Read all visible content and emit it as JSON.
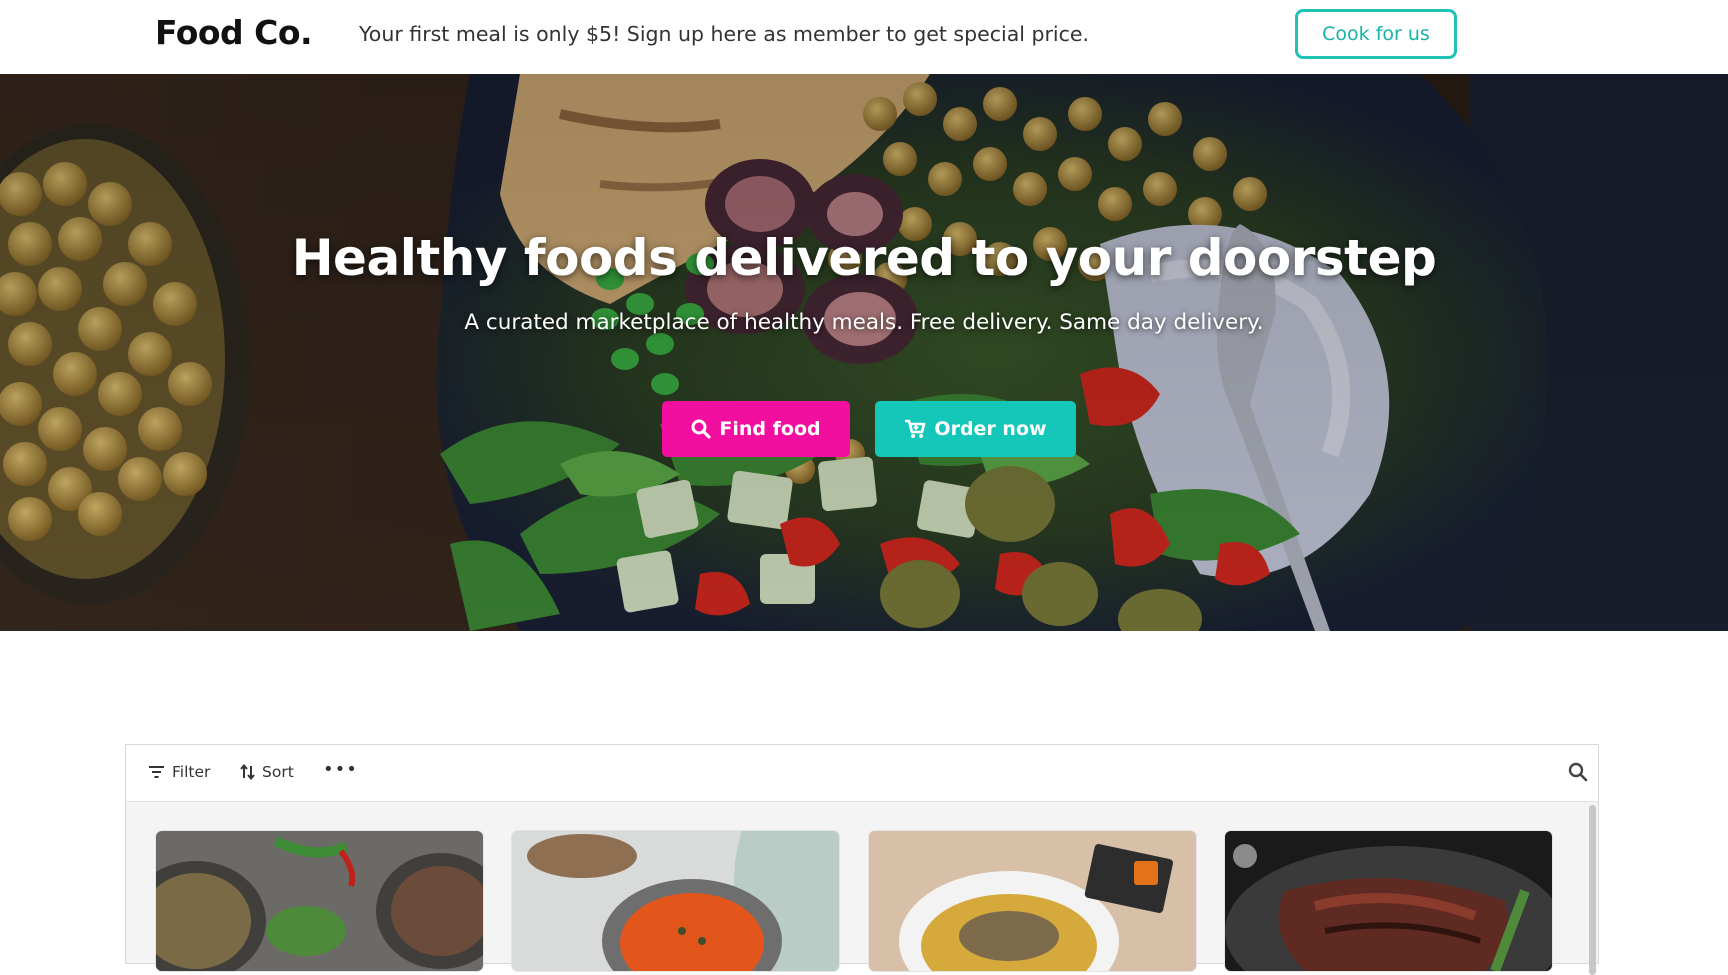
{
  "header": {
    "brand": "Food Co.",
    "promo": "Your first meal is only $5! Sign up here as member to get special price.",
    "cook_label": "Cook for us"
  },
  "hero": {
    "title": "Healthy foods delivered to your doorstep",
    "subtitle": "A curated marketplace of healthy meals. Free delivery. Same day delivery.",
    "find_label": "Find food",
    "order_label": "Order now"
  },
  "listing": {
    "filter_label": "Filter",
    "sort_label": "Sort",
    "more_label": "•••"
  },
  "colors": {
    "accent_teal": "#15c7b8",
    "accent_pink": "#f20f9f"
  }
}
